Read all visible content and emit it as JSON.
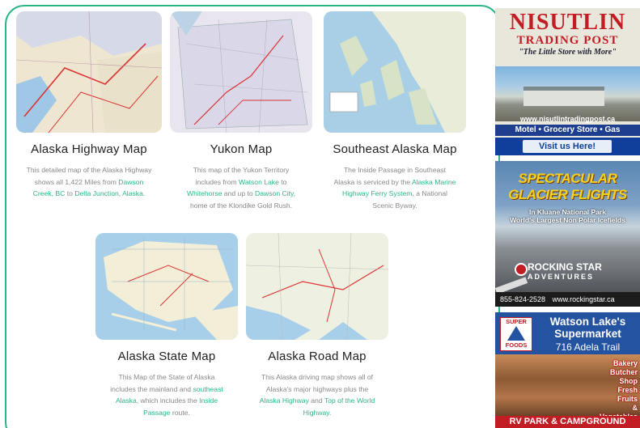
{
  "maps": [
    {
      "title": "Alaska Highway Map",
      "desc_pre": "This detailed map of the Alaska Highway shows all 1,422 Miles from ",
      "link1": "Dawson Creek, BC",
      "mid1": " to ",
      "link2": "Delta Junction, Alaska",
      "end": "."
    },
    {
      "title": "Yukon Map",
      "desc_pre": "This map of the Yukon Territory includes from ",
      "link1": "Watson Lake",
      "mid1": " to ",
      "link2": "Whitehorse",
      "mid2": " and up to ",
      "link3": "Dawson City",
      "end": ", home of the Klondike Gold Rush."
    },
    {
      "title": "Southeast Alaska Map",
      "desc_pre": "The Inside Passage in Southeast Alaska is serviced by the ",
      "link1": "Alaska Marine Highway Ferry System",
      "end": ", a National Scenic Byway."
    },
    {
      "title": "Alaska State Map",
      "desc_pre": "This Map of the State of Alaska includes the mainland and ",
      "link1": "southeast Alaska",
      "mid1": ", which includes the ",
      "link2": "Inside Passage",
      "end": " route."
    },
    {
      "title": "Alaska Road Map",
      "desc_pre": "This Alaska driving map shows all of Alaska's major highways plus the ",
      "link1": "Alaska Highway",
      "mid1": " and ",
      "link2": "Top of the World Highway",
      "end": "."
    }
  ],
  "ads": {
    "nisutlin": {
      "brand": "NISUTLIN",
      "brand2": "TRADING POST",
      "tagline": "\"The Little Store with More\"",
      "url": "www.nisutlintradingpost.ca",
      "services": "Motel • Grocery Store • Gas",
      "cta": "Visit us Here!"
    },
    "glacier": {
      "headline": "SPECTACULAR GLACIER FLIGHTS",
      "sub1": "In Kluane National Park",
      "sub2": "World's Largest Non Polar Icefields",
      "logo1": "ROCKING STAR",
      "logo2": "ADVENTURES",
      "phone": "855-824-2528",
      "url": "www.rockingstar.ca"
    },
    "watson": {
      "logo_top": "SUPER",
      "logo_bottom": "FOODS",
      "name": "Watson Lake's Supermarket",
      "address": "716 Adela Trail",
      "items": [
        "Bakery",
        "Butcher Shop",
        "Fresh Fruits",
        "& Vegetables"
      ],
      "footer": "RV PARK & CAMPGROUND"
    }
  }
}
